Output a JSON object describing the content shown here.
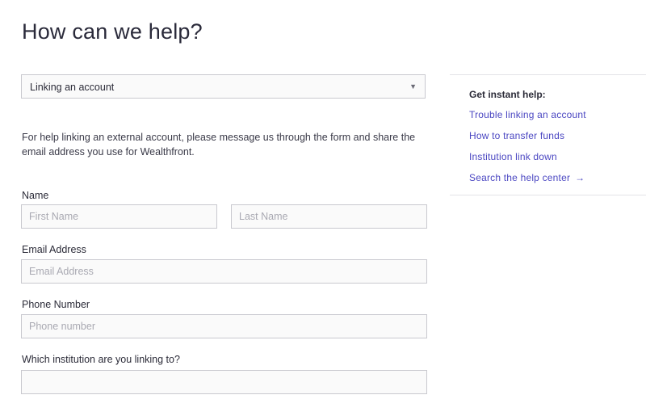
{
  "page": {
    "title": "How can we help?"
  },
  "topic_select": {
    "selected": "Linking an account",
    "caret_icon": "chevron-down-icon"
  },
  "helper_text": "For help linking an external account, please message us through the form and share the email address you use for Wealthfront.",
  "form": {
    "name_label": "Name",
    "first_name_placeholder": "First Name",
    "last_name_placeholder": "Last Name",
    "email_label": "Email Address",
    "email_placeholder": "Email Address",
    "phone_label": "Phone Number",
    "phone_placeholder": "Phone number",
    "institution_label": "Which institution are you linking to?",
    "institution_placeholder": ""
  },
  "sidebar": {
    "title": "Get instant help:",
    "links": [
      {
        "label": "Trouble linking an account"
      },
      {
        "label": "How to transfer funds"
      },
      {
        "label": "Institution link down"
      },
      {
        "label": "Search the help center",
        "icon": "arrow-right-icon",
        "icon_glyph": "→"
      }
    ]
  },
  "colors": {
    "link": "#4b47c2",
    "text": "#2b2b38",
    "field_border": "#c9c9cf",
    "field_bg": "#fafafa"
  }
}
